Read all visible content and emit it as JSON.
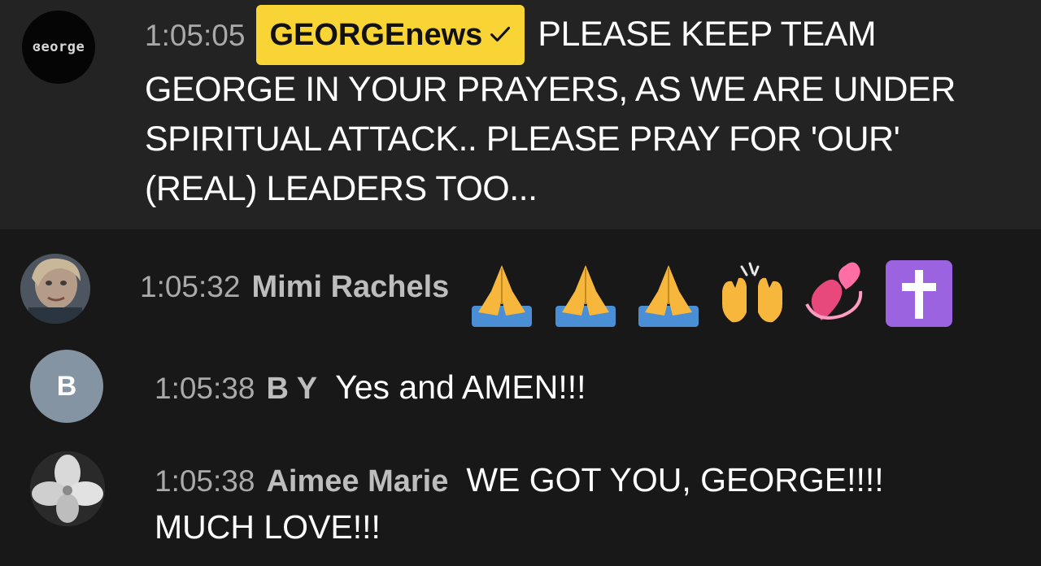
{
  "owner_message": {
    "avatar_text": "ɞeorge",
    "time": "1:05:05",
    "author": "GEORGEnews",
    "text": "PLEASE KEEP TEAM GEORGE IN YOUR PRAYERS, AS WE ARE UNDER SPIRITUAL ATTACK.. PLEASE PRAY FOR 'OUR' (REAL) LEADERS TOO...",
    "badge_color": "#f9d435"
  },
  "messages": [
    {
      "time": "1:05:32",
      "author": "Mimi Rachels",
      "emojis": [
        "folded-hands",
        "folded-hands",
        "folded-hands",
        "raising-hands",
        "revolving-hearts",
        "latin-cross"
      ]
    },
    {
      "avatar_letter": "B",
      "time": "1:05:38",
      "author": "B Y",
      "text": "Yes and AMEN!!!"
    },
    {
      "time": "1:05:38",
      "author": "Aimee Marie",
      "text_line1": "WE GOT YOU, GEORGE!!!!",
      "text_line2": "MUCH LOVE!!!"
    }
  ],
  "colors": {
    "background": "#181818",
    "owner_background": "#232323",
    "timestamp": "#aaaaaa",
    "author": "#bdbdbd",
    "text": "#ffffff"
  }
}
